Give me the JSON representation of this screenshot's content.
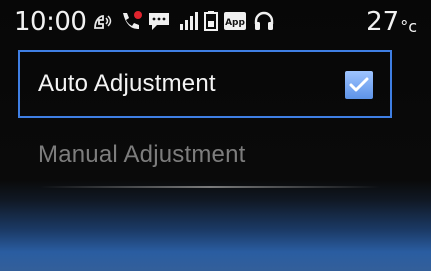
{
  "status_bar": {
    "time": "10:00",
    "temperature_value": "27",
    "temperature_unit": "°c",
    "icons": [
      "handsfree-phone-icon",
      "phone-call-icon",
      "message-icon",
      "signal-strength-icon",
      "battery-icon",
      "app-icon",
      "headphones-icon"
    ],
    "app_badge_text": "App"
  },
  "menu": {
    "items": [
      {
        "label": "Auto Adjustment",
        "selected": true,
        "checked": true
      },
      {
        "label": "Manual Adjustment",
        "selected": false,
        "checked": false
      }
    ]
  },
  "colors": {
    "selection_border": "#3f7fe4",
    "checkbox_fill": "#6a9cf0",
    "call_icon_red": "#e0242e",
    "disabled_text": "#7d7d7d"
  }
}
